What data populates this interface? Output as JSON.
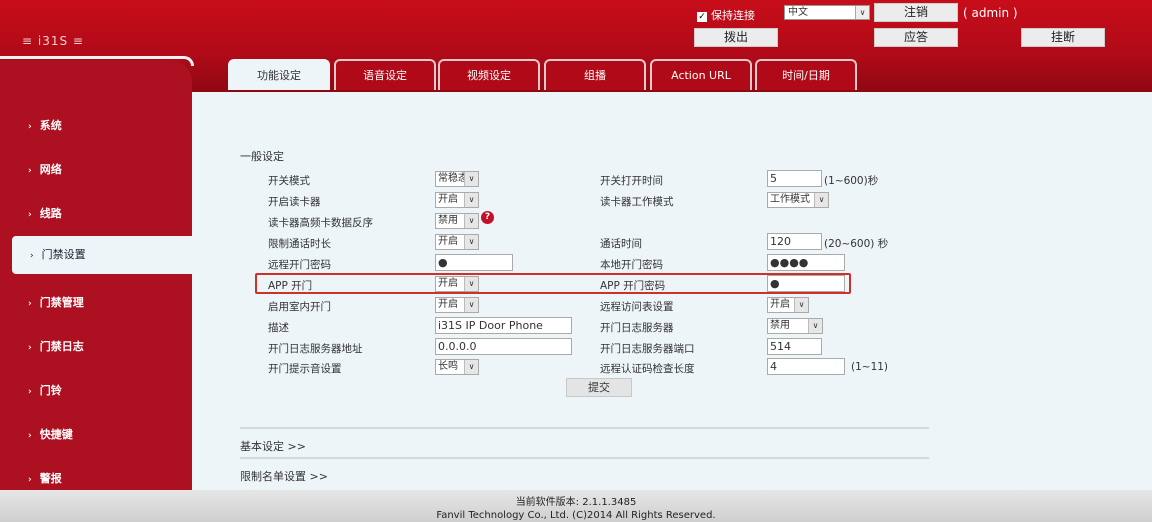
{
  "header": {
    "logo": "i31S",
    "keep_online": "保持连接",
    "keep_online_checked": true,
    "language": "中文",
    "logout": "注销",
    "user": "( admin )",
    "dial_out": "拨出",
    "answer": "应答",
    "hangup": "挂断"
  },
  "tabs": [
    {
      "label": "功能设定",
      "active": true
    },
    {
      "label": "语音设定"
    },
    {
      "label": "视频设定"
    },
    {
      "label": "组播"
    },
    {
      "label": "Action URL"
    },
    {
      "label": "时间/日期"
    }
  ],
  "sidebar": {
    "items": [
      {
        "label": "系统"
      },
      {
        "label": "网络"
      },
      {
        "label": "线路"
      },
      {
        "label": "门禁设置",
        "active": true
      },
      {
        "label": "门禁管理"
      },
      {
        "label": "门禁日志"
      },
      {
        "label": "门铃"
      },
      {
        "label": "快捷键"
      },
      {
        "label": "警报"
      }
    ]
  },
  "section": {
    "title": "一般设定"
  },
  "form": {
    "left": [
      {
        "label": "开关模式",
        "type": "select",
        "value": "常稳态"
      },
      {
        "label": "开启读卡器",
        "type": "select",
        "value": "开启"
      },
      {
        "label": "读卡器高频卡数据反序",
        "type": "select",
        "value": "禁用"
      },
      {
        "label": "限制通话时长",
        "type": "select",
        "value": "开启"
      },
      {
        "label": "远程开门密码",
        "type": "input",
        "value": "●"
      },
      {
        "label": "APP 开门",
        "type": "select",
        "value": "开启"
      },
      {
        "label": "启用室内开门",
        "type": "select",
        "value": "开启"
      },
      {
        "label": "描述",
        "type": "input",
        "value": "i31S IP Door Phone"
      },
      {
        "label": "开门日志服务器地址",
        "type": "input",
        "value": "0.0.0.0"
      },
      {
        "label": "开门提示音设置",
        "type": "select",
        "value": "长鸣"
      }
    ],
    "right": [
      {
        "label": "开关打开时间",
        "type": "input",
        "value": "5",
        "unit": "(1~600)秒"
      },
      {
        "label": "读卡器工作模式",
        "type": "select",
        "value": "工作模式"
      },
      {
        "label": "",
        "type": "none"
      },
      {
        "label": "通话时间",
        "type": "input",
        "value": "120",
        "unit": "(20~600) 秒"
      },
      {
        "label": "本地开门密码",
        "type": "input",
        "value": "●●●●"
      },
      {
        "label": "APP 开门密码",
        "type": "input",
        "value": "●"
      },
      {
        "label": "远程访问表设置",
        "type": "select",
        "value": "开启"
      },
      {
        "label": "开门日志服务器",
        "type": "select",
        "value": "禁用"
      },
      {
        "label": "开门日志服务器端口",
        "type": "input",
        "value": "514"
      },
      {
        "label": "远程认证码检查长度",
        "type": "input",
        "value": "4",
        "unit": "(1~11)"
      }
    ],
    "submit": "提交",
    "help_icon": "?"
  },
  "links": {
    "basic": "基本设定 >>",
    "restrict": "限制名单设置 >>"
  },
  "footer": {
    "version": "当前软件版本: 2.1.1.3485",
    "copyright": "Fanvil Technology Co., Ltd. (C)2014 All Rights Reserved."
  },
  "colors": {
    "brand_red": "#ad1020",
    "highlight_box": "#d0302a"
  }
}
